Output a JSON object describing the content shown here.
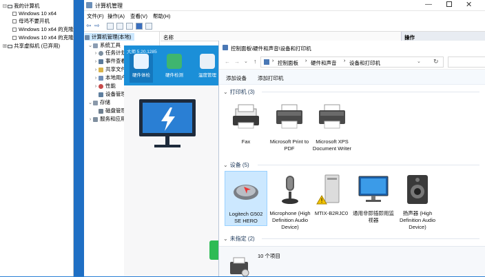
{
  "vm_tree": {
    "root": "我的计算机",
    "items": [
      "Windows 10 x64",
      "母鸡不要开机",
      "Windows 10 x64 的克隆",
      "Windows 10 x64 的克隆"
    ],
    "shared": "共享虚拟机 (已弃用)"
  },
  "comp_mgmt": {
    "title": "计算机管理",
    "menu": [
      "文件(F)",
      "操作(A)",
      "查看(V)",
      "帮助(H)"
    ],
    "column_name": "名称",
    "column_actions": "操作",
    "tree": [
      {
        "label": "计算机管理(本地)",
        "level": 0,
        "selected": true
      },
      {
        "label": "系统工具",
        "level": 1
      },
      {
        "label": "任务计划",
        "level": 2
      },
      {
        "label": "事件查看",
        "level": 2
      },
      {
        "label": "共享文件",
        "level": 2
      },
      {
        "label": "本地用户",
        "level": 2
      },
      {
        "label": "性能",
        "level": 2
      },
      {
        "label": "设备管理",
        "level": 2
      },
      {
        "label": "存储",
        "level": 1
      },
      {
        "label": "磁盘管理",
        "level": 2
      },
      {
        "label": "服务和应用",
        "level": 1
      }
    ]
  },
  "dashi": {
    "title": "大师 5.20.1285",
    "tabs": [
      "硬件体检",
      "硬件检测",
      "温度管理"
    ]
  },
  "control_panel": {
    "title": "控制面板\\硬件和声音\\设备和打印机",
    "breadcrumb": [
      "控制面板",
      "硬件和声音",
      "设备和打印机"
    ],
    "actions": [
      "添加设备",
      "添加打印机"
    ],
    "printers_header": "打印机 (3)",
    "printers": [
      "Fax",
      "Microsoft Print to PDF",
      "Microsoft XPS Document Writer"
    ],
    "devices_header": "设备 (5)",
    "devices": [
      "Logitech G502 SE HERO",
      "Microphone (High Definition Audio Device)",
      "MTIX-B2RJC0",
      "通用非即插即用监视器",
      "扬声器 (High Definition Audio Device)"
    ],
    "unspecified_header": "未指定 (2)",
    "status": "10 个项目"
  }
}
